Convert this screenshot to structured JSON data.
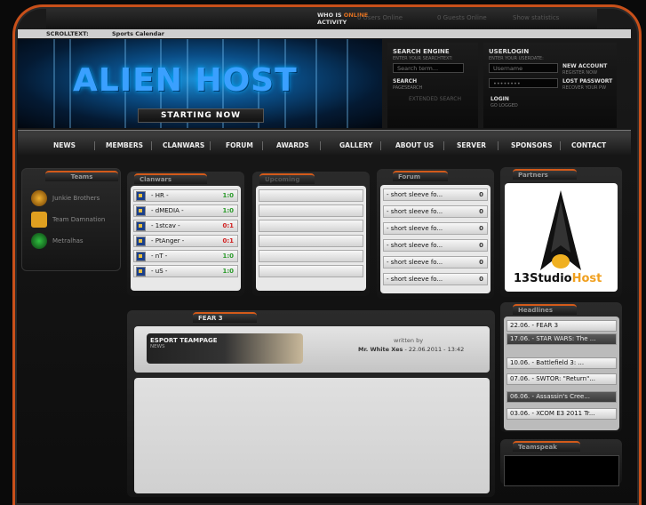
{
  "topbar": {
    "who_is": "WHO IS",
    "online": "ONLINE",
    "activity": "ACTIVITY",
    "users_online": "0 Users Online",
    "guests_online": "0 Guests Online",
    "show_statistics": "Show statistics"
  },
  "scroll": {
    "label": "SCROLLTEXT:",
    "text": "Sports Calendar"
  },
  "banner": {
    "title": "ALIEN HOST",
    "button": "STARTING NOW"
  },
  "search": {
    "title": "SEARCH ENGINE",
    "subtitle": "ENTER YOUR SEARCHTEXT:",
    "placeholder": "Search term...",
    "search_link": "SEARCH",
    "search_sub": "PAGESEARCH",
    "extended": "EXTENDED SEARCH"
  },
  "login": {
    "title": "USERLOGIN",
    "subtitle": "ENTER YOUR USERDATE:",
    "username_placeholder": "Username",
    "password_value": "••••••••",
    "new_account": "NEW ACCOUNT",
    "register_now": "REGISTER NOW",
    "lost_password": "LOST PASSWORT",
    "recover": "RECOVER YOUR PW",
    "login_btn": "LOGIN",
    "go_logged": "GO LOGGED"
  },
  "nav": [
    "NEWS",
    "MEMBERS",
    "CLANWARS",
    "FORUM",
    "AWARDS",
    "GALLERY",
    "ABOUT US",
    "SERVER",
    "SPONSORS",
    "CONTACT"
  ],
  "teams": {
    "title": "Teams",
    "items": [
      "Junkie Brothers",
      "Team Damnation",
      "Metralhas"
    ]
  },
  "clanwars": {
    "title": "Clanwars",
    "rows": [
      {
        "name": "- HR -",
        "score": "1:0",
        "win": true
      },
      {
        "name": "- dMEDIA -",
        "score": "1:0",
        "win": true
      },
      {
        "name": "- 1stcav -",
        "score": "0:1",
        "win": false
      },
      {
        "name": "- PtAnger -",
        "score": "0:1",
        "win": false
      },
      {
        "name": "- nT -",
        "score": "1:0",
        "win": true
      },
      {
        "name": "- uS -",
        "score": "1:0",
        "win": true
      }
    ]
  },
  "upcoming": {
    "title": "Upcoming"
  },
  "forum": {
    "title": "Forum",
    "rows": [
      {
        "text": "- short sleeve fo...",
        "count": "0"
      },
      {
        "text": "- short sleeve fo...",
        "count": "0"
      },
      {
        "text": "- short sleeve fo...",
        "count": "0"
      },
      {
        "text": "- short sleeve fo...",
        "count": "0"
      },
      {
        "text": "- short sleeve fo...",
        "count": "0"
      },
      {
        "text": "- short sleeve fo...",
        "count": "0"
      }
    ]
  },
  "partners": {
    "title": "Partners",
    "logo_text_dark": "13Studio",
    "logo_text_accent": "Host"
  },
  "news": {
    "title": "FEAR 3",
    "banner_title": "ESPORT TEAMPAGE",
    "banner_sub": "NEWS",
    "written_by": "written by",
    "author": "Mr. White Xes",
    "date": " - 22.06.2011 - 13:42"
  },
  "headlines": {
    "title": "Headlines",
    "rows": [
      "22.06. - FEAR 3",
      "17.06. - STAR WARS: The ...",
      "10.06. - Battlefield 3: ...",
      "07.06. - SWTOR: \"Return\"...",
      "06.06. - Assassin's Cree...",
      "03.06. - XCOM E3 2011 Tr..."
    ]
  },
  "teamspeak": {
    "title": "Teamspeak"
  },
  "colors": {
    "accent": "#d35a1a",
    "win": "#2a9a2a",
    "loss": "#d02020",
    "banner_blue": "#1b8fd6"
  }
}
